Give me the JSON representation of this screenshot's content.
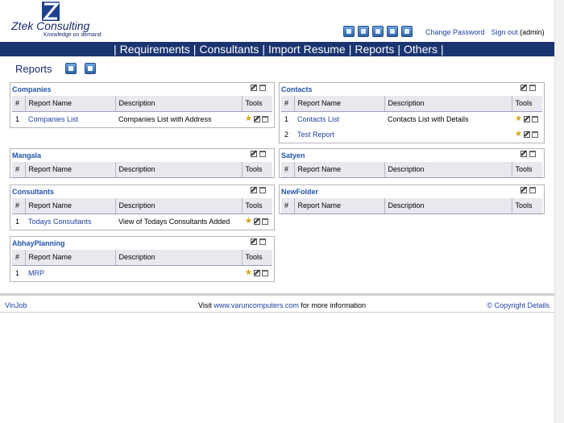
{
  "brand": {
    "name": "Ztek Consulting",
    "tagline": "Knowledge on demand"
  },
  "top_links": {
    "change_password": "Change Password",
    "sign_out": "Sign out",
    "user": "(admin)"
  },
  "top_icons": [
    "folder-icon",
    "calendar-icon",
    "clock-icon",
    "list-icon",
    "contacts-icon"
  ],
  "nav": [
    "Requirements",
    "Consultants",
    "Import Resume",
    "Reports",
    "Others"
  ],
  "page": {
    "title": "Reports"
  },
  "columns": {
    "num": "#",
    "report_name": "Report Name",
    "description": "Description",
    "tools": "Tools"
  },
  "panels": {
    "companies": {
      "title": "Companies",
      "rows": [
        {
          "num": "1",
          "name": "Companies List",
          "description": "Companies List with Address"
        }
      ]
    },
    "mangala": {
      "title": "Mangala"
    },
    "consultants": {
      "title": "Consultants",
      "rows": [
        {
          "num": "1",
          "name": "Todays Consultants",
          "description": "View of Todays Consultants Added"
        }
      ]
    },
    "abhay": {
      "title": "AbhayPlanning",
      "rows": [
        {
          "num": "1",
          "name": "MRP",
          "description": ""
        }
      ]
    },
    "contacts": {
      "title": "Contacts",
      "rows": [
        {
          "num": "1",
          "name": "Contacts List",
          "description": "Contacts List with Details"
        },
        {
          "num": "2",
          "name": "Test Report",
          "description": ""
        }
      ]
    },
    "satyen": {
      "title": "Satyen"
    },
    "newfolder": {
      "title": "NewFolder"
    }
  },
  "footer": {
    "left": "VinJob",
    "visit": "Visit",
    "site": "www.varuncomputers.com",
    "more": "for more information",
    "right": "© Copyright Details"
  },
  "colors": {
    "navbar": "#1a3470",
    "link": "#1f3fa0",
    "panel_title": "#2255aa"
  }
}
